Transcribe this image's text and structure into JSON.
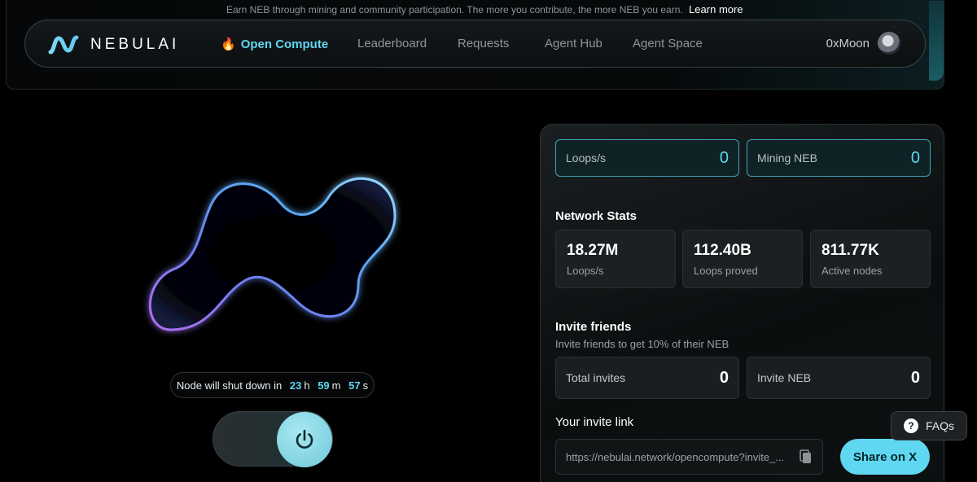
{
  "banner": {
    "text": "Earn NEB through mining and community participation. The more you contribute, the more NEB you earn.",
    "learn_more": "Learn more"
  },
  "nav": {
    "logo": "NEBULAI",
    "items": [
      {
        "label": "Open Compute",
        "active": true
      },
      {
        "label": "Leaderboard"
      },
      {
        "label": "Requests"
      },
      {
        "label": "Agent Hub"
      },
      {
        "label": "Agent Space"
      }
    ],
    "user": "0xMoon"
  },
  "node": {
    "timer_prefix": "Node will shut down in",
    "hours": "23",
    "h": "h",
    "minutes": "59",
    "m": "m",
    "seconds": "57",
    "s": "s",
    "power_on": true
  },
  "mining": {
    "loops_label": "Loops/s",
    "loops_value": "0",
    "neb_label": "Mining NEB",
    "neb_value": "0"
  },
  "network": {
    "title": "Network Stats",
    "stats": [
      {
        "value": "18.27M",
        "label": "Loops/s"
      },
      {
        "value": "112.40B",
        "label": "Loops proved"
      },
      {
        "value": "811.77K",
        "label": "Active nodes"
      }
    ]
  },
  "invite": {
    "title": "Invite friends",
    "subtitle": "Invite friends to get 10% of their NEB",
    "total_label": "Total invites",
    "total_value": "0",
    "neb_label": "Invite NEB",
    "neb_value": "0",
    "link_title": "Your invite link",
    "link": "https://nebulai.network/opencompute?invite_...",
    "share_label": "Share on X"
  },
  "faq": {
    "label": "FAQs"
  },
  "colors": {
    "accent": "#5fd7f0",
    "background": "#000000"
  }
}
